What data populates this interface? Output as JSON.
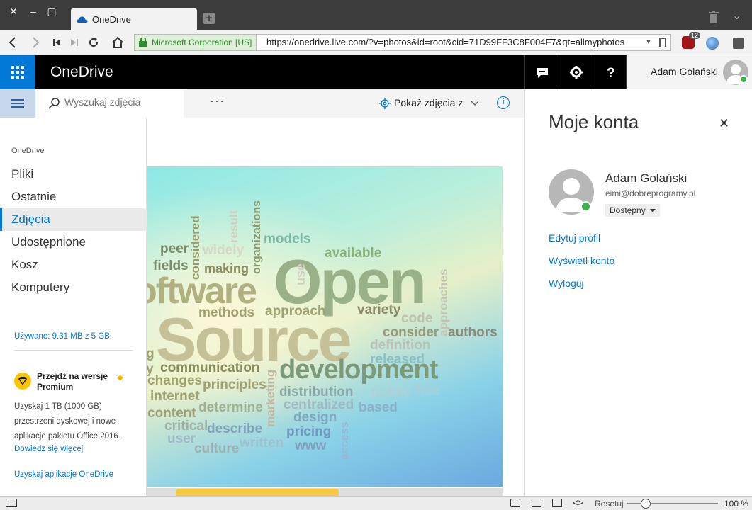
{
  "browser": {
    "tab_title": "OneDrive",
    "ssl_label": "Microsoft Corporation [US]",
    "url": "https://onedrive.live.com/?v=photos&id=root&cid=71D99FF3C8F004F7&qt=allmyphotos",
    "ext_badge_count": "12"
  },
  "header": {
    "brand": "OneDrive",
    "user_name": "Adam Golański"
  },
  "cmdbar": {
    "search_placeholder": "Wyszukaj zdjęcia",
    "more_label": "···",
    "show_photos_label": "Pokaż zdjęcia z"
  },
  "leftnav": {
    "section_label": "OneDrive",
    "items": [
      {
        "label": "Pliki"
      },
      {
        "label": "Ostatnie"
      },
      {
        "label": "Zdjęcia"
      },
      {
        "label": "Udostępnione"
      },
      {
        "label": "Kosz"
      },
      {
        "label": "Komputery"
      }
    ],
    "active_item": "Zdjęcia",
    "storage_label": "Używane: 9.31 MB z 5 GB",
    "premium_title": "Przejdź na wersję Premium",
    "premium_desc": "Uzyskaj 1 TB (1000 GB) przestrzeni dyskowej i nowe aplikacje pakietu Office 2016.",
    "premium_link": "Dowiedz się więcej",
    "apps_link": "Uzyskaj aplikacje OneDrive"
  },
  "photo": {
    "words": [
      "peer",
      "widely",
      "fields",
      "making",
      "considered",
      "result",
      "organizations",
      "models",
      "available",
      "Open",
      "use",
      "oftware",
      "methods",
      "approach",
      "variety",
      "code",
      "approaches",
      "Source",
      "consider",
      "authors",
      "definition",
      "released",
      "g",
      "communication",
      "development",
      "y",
      "changes",
      "principles",
      "marketing",
      "distribution",
      "public",
      "free",
      "internet",
      "centralized",
      "based",
      "content",
      "determine",
      "design",
      "critical",
      "describe",
      "pricing",
      "user",
      "culture",
      "written",
      "www",
      "access"
    ]
  },
  "rightpane": {
    "title": "Moje konta",
    "name": "Adam Golański",
    "email": "eimi@dobreprogramy.pl",
    "status": "Dostępny",
    "links": [
      "Edytuj profil",
      "Wyświetl konto",
      "Wyloguj"
    ]
  },
  "statusbar": {
    "reset_label": "Resetuj",
    "zoom": "100 %"
  },
  "colors": {
    "accent": "#0078d7",
    "header_bg": "#000000",
    "online_status": "#3fb04f"
  }
}
